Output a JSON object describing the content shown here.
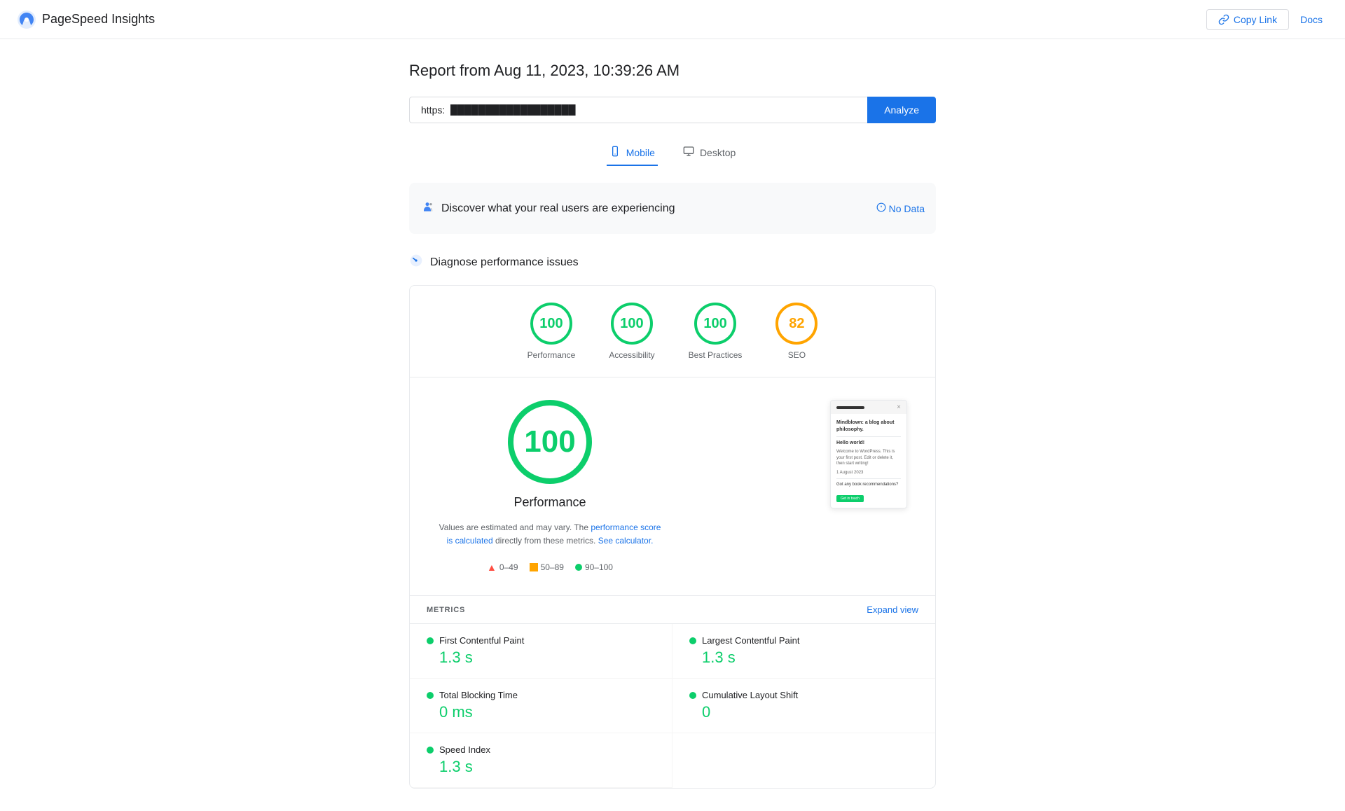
{
  "header": {
    "logo_text": "PageSpeed Insights",
    "copy_link_label": "Copy Link",
    "docs_label": "Docs"
  },
  "report": {
    "title": "Report from Aug 11, 2023, 10:39:26 AM",
    "url_value": "https:",
    "url_redacted": "███████████████",
    "analyze_label": "Analyze"
  },
  "tabs": [
    {
      "label": "Mobile",
      "icon": "📱",
      "active": true
    },
    {
      "label": "Desktop",
      "icon": "🖥",
      "active": false
    }
  ],
  "discover_section": {
    "label": "Discover what your real users are experiencing",
    "no_data_label": "No Data"
  },
  "diagnose_section": {
    "label": "Diagnose performance issues"
  },
  "scores": [
    {
      "label": "Performance",
      "value": "100",
      "color": "green"
    },
    {
      "label": "Accessibility",
      "value": "100",
      "color": "green"
    },
    {
      "label": "Best Practices",
      "value": "100",
      "color": "green"
    },
    {
      "label": "SEO",
      "value": "82",
      "color": "orange"
    }
  ],
  "performance": {
    "score": "100",
    "title": "Performance",
    "desc_text": "Values are estimated and may vary. The",
    "desc_link": "performance score is calculated",
    "desc_text2": "directly from these metrics.",
    "calc_link": "See calculator.",
    "legend": [
      {
        "type": "triangle",
        "range": "0–49"
      },
      {
        "type": "square",
        "range": "50–89"
      },
      {
        "type": "circle",
        "range": "90–100"
      }
    ]
  },
  "screenshot": {
    "bar_label": "",
    "close_label": "×",
    "title": "Mindblown: a blog about philosophy.",
    "heading": "Hello world!",
    "body": "Welcome to WordPress. This is your first post. Edit or delete it, then start writing!",
    "date": "1 August 2023",
    "cta_label": "Got any book recommendations?",
    "btn_label": "Get in touch"
  },
  "metrics": {
    "section_label": "METRICS",
    "expand_label": "Expand view",
    "items": [
      {
        "name": "First Contentful Paint",
        "value": "1.3 s",
        "color": "green"
      },
      {
        "name": "Largest Contentful Paint",
        "value": "1.3 s",
        "color": "green"
      },
      {
        "name": "Total Blocking Time",
        "value": "0 ms",
        "color": "green"
      },
      {
        "name": "Cumulative Layout Shift",
        "value": "0",
        "color": "green"
      },
      {
        "name": "Speed Index",
        "value": "1.3 s",
        "color": "green"
      }
    ]
  }
}
